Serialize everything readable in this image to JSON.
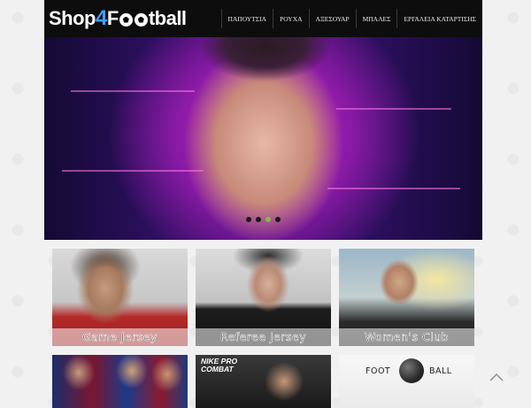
{
  "logo": {
    "prefix": "Shop",
    "number": "4",
    "letter_f": "F",
    "suffix_after_balls": "tball",
    "brand_color": "#3fa0ff"
  },
  "nav": {
    "items": [
      {
        "label": "ΠΑΠΟΥΤΣΙΑ"
      },
      {
        "label": "ΡΟΥΧΑ"
      },
      {
        "label": "ΑΞΕΣΟΥΑΡ"
      },
      {
        "label": "ΜΠΑΛΕΣ"
      },
      {
        "label": "ΕΡΓΑΛΕΙΑ ΚΑΤΑΡΤΙΣΗΣ"
      }
    ]
  },
  "slider": {
    "slide_count": 4,
    "active_index": 2,
    "active_color": "#7bc043"
  },
  "categories": [
    {
      "label": "Game Jersey"
    },
    {
      "label": "Referee Jersey"
    },
    {
      "label": "Women's Club"
    }
  ],
  "promo_tiles": {
    "nike_line1": "NIKE PRO",
    "nike_line2": "COMBAT",
    "football_left": "FOOT",
    "football_right": "BALL"
  },
  "icons": {
    "back_to_top": "chevron-up-icon"
  }
}
